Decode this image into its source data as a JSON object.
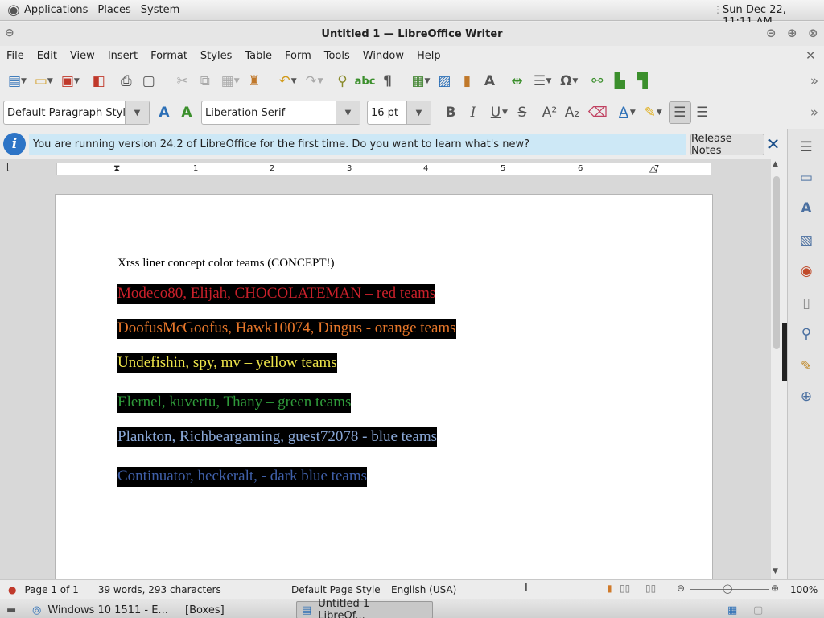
{
  "top_panel": {
    "applications": "Applications",
    "places": "Places",
    "system": "System",
    "clock": "Sun Dec 22, 11:11 AM"
  },
  "window": {
    "title": "Untitled 1 — LibreOffice Writer"
  },
  "menu": [
    "File",
    "Edit",
    "View",
    "Insert",
    "Format",
    "Styles",
    "Table",
    "Form",
    "Tools",
    "Window",
    "Help"
  ],
  "formatting": {
    "paragraph_style": "Default Paragraph Style",
    "font_name": "Liberation Serif",
    "font_size": "16 pt"
  },
  "infobar": {
    "message": "You are running version 24.2 of LibreOffice for the first time. Do you want to learn what's new?",
    "button": "Release Notes"
  },
  "ruler_numbers": [
    "1",
    "2",
    "3",
    "4",
    "5",
    "6",
    "7"
  ],
  "document": {
    "heading": "Xrss liner concept color teams (CONCEPT!)",
    "lines": [
      {
        "text": "Modeco80, Elijah, CHOCOLATEMAN – red teams",
        "color": "#c8202a"
      },
      {
        "text": "DoofusMcGoofus, Hawk10074, Dingus - orange teams",
        "color": "#e8772a"
      },
      {
        "text": "Undefishin, spy, mv – yellow teams",
        "color": "#ece34a"
      },
      {
        "text": "Elernel, kuvertu, Thany – green teams",
        "color": "#2f9a3a"
      },
      {
        "text": "Plankton, Richbeargaming, guest72078 - blue teams",
        "color": "#8aa8d8"
      },
      {
        "text": "Continuator, heckeralt, - dark blue teams",
        "color": "#3f5fa8"
      }
    ]
  },
  "statusbar": {
    "page": "Page 1 of 1",
    "words": "39 words, 293 characters",
    "page_style": "Default Page Style",
    "language": "English (USA)",
    "zoom": "100%"
  },
  "taskbar": {
    "items": [
      "Windows 10 1511 - E...",
      "[Boxes]",
      "Untitled 1 — LibreOf..."
    ]
  }
}
